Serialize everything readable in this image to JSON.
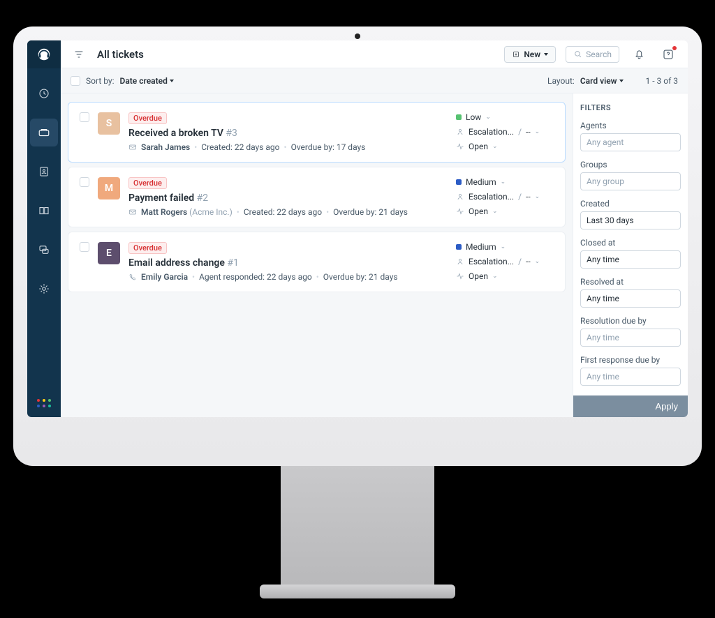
{
  "header": {
    "title": "All tickets",
    "new_button": "New",
    "search_placeholder": "Search"
  },
  "subbar": {
    "sort_label": "Sort by:",
    "sort_value": "Date created",
    "layout_label": "Layout:",
    "layout_value": "Card view",
    "pagination": "1 - 3 of 3"
  },
  "tickets": [
    {
      "badge": "Overdue",
      "title": "Received a broken TV",
      "id": "#3",
      "contact": "Sarah James",
      "company": "",
      "meta_action": "Created",
      "meta_time": "22 days ago",
      "overdue_label": "Overdue by:",
      "overdue_value": "17 days",
      "priority": "Low",
      "priority_class": "pri-low",
      "escalation": "Escalation...",
      "escalation_value": "--",
      "status": "Open",
      "avatar_class": "av-1",
      "avatar_initial": "S",
      "highlight": true,
      "contact_icon": "mail"
    },
    {
      "badge": "Overdue",
      "title": "Payment failed",
      "id": "#2",
      "contact": "Matt Rogers",
      "company": "(Acme Inc.)",
      "meta_action": "Created",
      "meta_time": "22 days ago",
      "overdue_label": "Overdue by:",
      "overdue_value": "21 days",
      "priority": "Medium",
      "priority_class": "pri-med",
      "escalation": "Escalation...",
      "escalation_value": "--",
      "status": "Open",
      "avatar_class": "av-2",
      "avatar_initial": "M",
      "highlight": false,
      "contact_icon": "mail"
    },
    {
      "badge": "Overdue",
      "title": "Email address change",
      "id": "#1",
      "contact": "Emily Garcia",
      "company": "",
      "meta_action": "Agent responded",
      "meta_time": "22 days ago",
      "overdue_label": "Overdue by:",
      "overdue_value": "21 days",
      "priority": "Medium",
      "priority_class": "pri-med",
      "escalation": "Escalation...",
      "escalation_value": "--",
      "status": "Open",
      "avatar_class": "av-3",
      "avatar_initial": "E",
      "highlight": false,
      "contact_icon": "phone"
    }
  ],
  "filters": {
    "heading": "FILTERS",
    "groups": [
      {
        "label": "Agents",
        "value": "Any agent",
        "placeholder": true
      },
      {
        "label": "Groups",
        "value": "Any group",
        "placeholder": true
      },
      {
        "label": "Created",
        "value": "Last 30 days",
        "placeholder": false
      },
      {
        "label": "Closed at",
        "value": "Any time",
        "placeholder": false
      },
      {
        "label": "Resolved at",
        "value": "Any time",
        "placeholder": false
      },
      {
        "label": "Resolution due by",
        "value": "Any time",
        "placeholder": true
      },
      {
        "label": "First response due by",
        "value": "Any time",
        "placeholder": true
      }
    ],
    "apply": "Apply"
  },
  "icons": {
    "separator": "/"
  }
}
